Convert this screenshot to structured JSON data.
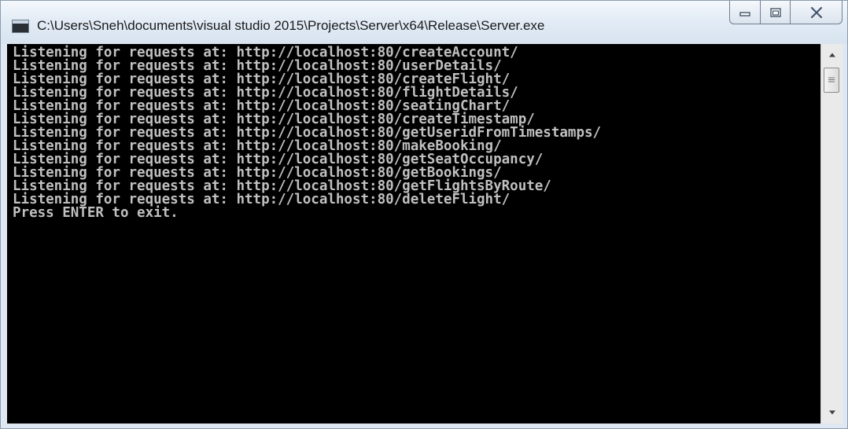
{
  "window": {
    "title": "C:\\Users\\Sneh\\documents\\visual studio 2015\\Projects\\Server\\x64\\Release\\Server.exe",
    "icon": "console-app-icon"
  },
  "caption_buttons": [
    {
      "name": "minimize",
      "icon": "minimize-icon"
    },
    {
      "name": "maximize",
      "icon": "maximize-icon"
    },
    {
      "name": "close",
      "icon": "close-icon"
    }
  ],
  "console": {
    "background": "#000000",
    "foreground": "#c0c0c0",
    "lines": [
      "Listening for requests at: http://localhost:80/createAccount/",
      "Listening for requests at: http://localhost:80/userDetails/",
      "Listening for requests at: http://localhost:80/createFlight/",
      "Listening for requests at: http://localhost:80/flightDetails/",
      "Listening for requests at: http://localhost:80/seatingChart/",
      "Listening for requests at: http://localhost:80/createTimestamp/",
      "Listening for requests at: http://localhost:80/getUseridFromTimestamps/",
      "Listening for requests at: http://localhost:80/makeBooking/",
      "Listening for requests at: http://localhost:80/getSeatOccupancy/",
      "Listening for requests at: http://localhost:80/getBookings/",
      "Listening for requests at: http://localhost:80/getFlightsByRoute/",
      "Listening for requests at: http://localhost:80/deleteFlight/",
      "Press ENTER to exit."
    ]
  },
  "scrollbar": {
    "up_icon": "chevron-up-icon",
    "down_icon": "chevron-down-icon",
    "thumb_icon": "grip-icon"
  }
}
